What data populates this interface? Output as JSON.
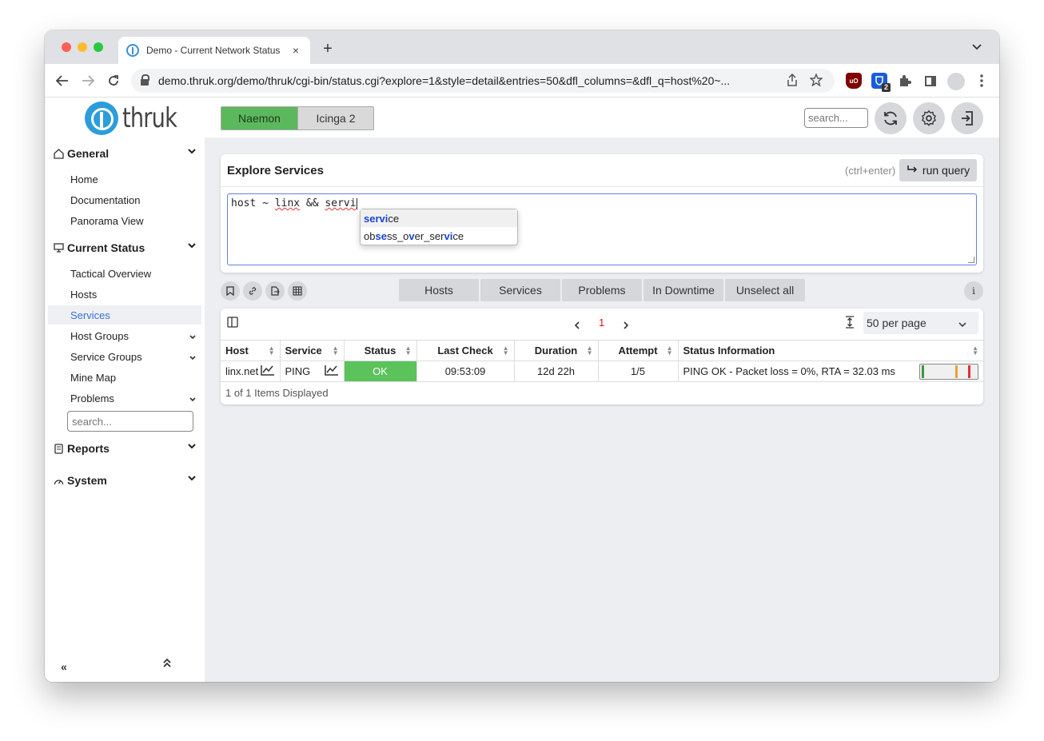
{
  "browser": {
    "tab_title": "Demo - Current Network Status",
    "tab_close": "×",
    "new_tab": "+",
    "url": "demo.thruk.org/demo/thruk/cgi-bin/status.cgi?explore=1&style=detail&entries=50&dfl_columns=&dfl_q=host%20~...",
    "extension_badge": "2",
    "extension_ublock": "uO"
  },
  "sidebar": {
    "logo_text": "thruk",
    "sections": {
      "general": "General",
      "current_status": "Current Status",
      "reports": "Reports",
      "system": "System"
    },
    "general_items": [
      "Home",
      "Documentation",
      "Panorama View"
    ],
    "status_items": [
      "Tactical Overview",
      "Hosts",
      "Services",
      "Host Groups",
      "Service Groups",
      "Mine Map",
      "Problems"
    ],
    "search_placeholder": "search...",
    "collapse_left": "«",
    "collapse_up": "⌃"
  },
  "topbar": {
    "backend_active": "Naemon",
    "backend_other": "Icinga 2",
    "search_placeholder": "search..."
  },
  "explore": {
    "title": "Explore Services",
    "hint": "(ctrl+enter)",
    "run_label": "run query",
    "query_parts": [
      "host ~ ",
      "linx",
      " && ",
      "servi"
    ],
    "suggestions": [
      {
        "parts": [
          "servi",
          "ce"
        ]
      },
      {
        "parts": [
          "ob",
          "se",
          "ss_o",
          "v",
          "er_ser",
          "vi",
          "ce"
        ]
      }
    ]
  },
  "filters": [
    "Hosts",
    "Services",
    "Problems",
    "In Downtime",
    "Unselect all"
  ],
  "info_label": "i",
  "pager": {
    "prev": "‹",
    "current": "1",
    "next": "›",
    "per_page": "50 per page"
  },
  "table": {
    "columns": [
      "Host",
      "Service",
      "Status",
      "Last Check",
      "Duration",
      "Attempt",
      "Status Information"
    ],
    "rows": [
      {
        "host": "linx.net",
        "service": "PING",
        "status": "OK",
        "last_check": "09:53:09",
        "duration": "12d 22h",
        "attempt": "1/5",
        "info": "PING OK - Packet loss = 0%, RTA = 32.03 ms"
      }
    ],
    "footer": "1 of 1 Items Displayed"
  },
  "colors": {
    "ok": "#5cc25c",
    "active_backend": "#5cb85c",
    "link_active": "#3b6fd6",
    "current_page": "#dd1111"
  }
}
